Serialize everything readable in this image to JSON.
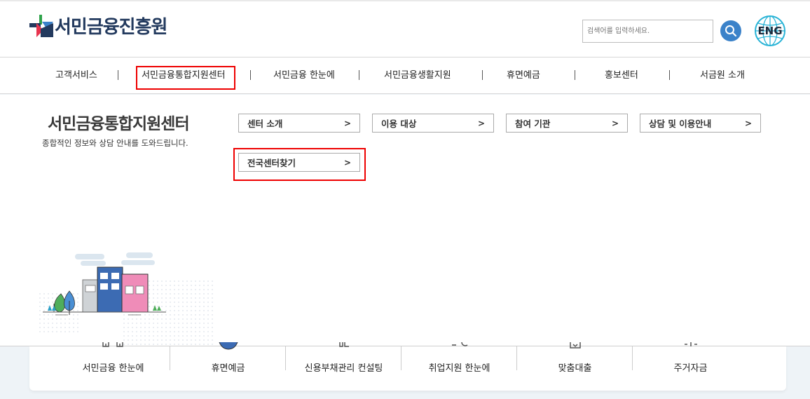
{
  "header": {
    "logo_text": "서민금융진흥원",
    "search_placeholder": "검색어를 입력하세요.",
    "eng_label": "ENG"
  },
  "gnb": {
    "items": [
      {
        "label": "고객서비스"
      },
      {
        "label": "서민금융통합지원센터"
      },
      {
        "label": "서민금융 한눈에"
      },
      {
        "label": "서민금융생활지원"
      },
      {
        "label": "휴면예금"
      },
      {
        "label": "홍보센터"
      },
      {
        "label": "서금원 소개"
      }
    ],
    "active_index": 1
  },
  "panel": {
    "title": "서민금융통합지원센터",
    "description": "종합적인 정보와 상담 안내를 도와드립니다.",
    "submenu": [
      {
        "label": "센터 소개"
      },
      {
        "label": "이용 대상"
      },
      {
        "label": "참여 기관"
      },
      {
        "label": "상담 및 이용안내"
      },
      {
        "label": "전국센터찾기"
      }
    ],
    "chevron": ">"
  },
  "quick_menu": {
    "items": [
      {
        "label": "서민금융 한눈에"
      },
      {
        "label": "휴면예금"
      },
      {
        "label": "신용부채관리 컨설팅"
      },
      {
        "label": "취업지원 한눈에"
      },
      {
        "label": "맞춤대출"
      },
      {
        "label": "주거자금"
      }
    ]
  },
  "colors": {
    "brand_navy": "#233a5e",
    "search_blue": "#3b82c9",
    "highlight_red": "#ee0000"
  }
}
